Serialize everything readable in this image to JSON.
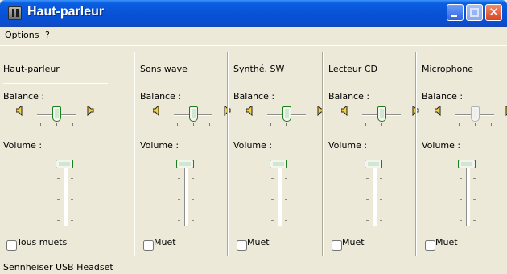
{
  "window": {
    "title": "Haut-parleur"
  },
  "menu": {
    "items": [
      "Options",
      "?"
    ]
  },
  "columns": [
    {
      "title": "Haut-parleur",
      "balance_label": "Balance :",
      "volume_label": "Volume :",
      "mute_label": "Tous muets",
      "balance_enabled": true
    },
    {
      "title": "Sons wave",
      "balance_label": "Balance :",
      "volume_label": "Volume :",
      "mute_label": "Muet",
      "balance_enabled": true
    },
    {
      "title": "Synthé. SW",
      "balance_label": "Balance :",
      "volume_label": "Volume :",
      "mute_label": "Muet",
      "balance_enabled": true
    },
    {
      "title": "Lecteur CD",
      "balance_label": "Balance :",
      "volume_label": "Volume :",
      "mute_label": "Muet",
      "balance_enabled": true
    },
    {
      "title": "Microphone",
      "balance_label": "Balance :",
      "volume_label": "Volume :",
      "mute_label": "Muet",
      "balance_enabled": false
    }
  ],
  "status": {
    "text": "Sennheiser USB Headset"
  },
  "colors": {
    "titlebar": "#0851d6",
    "thumb_border": "#1b7f1b",
    "face": "#ece9d8"
  }
}
